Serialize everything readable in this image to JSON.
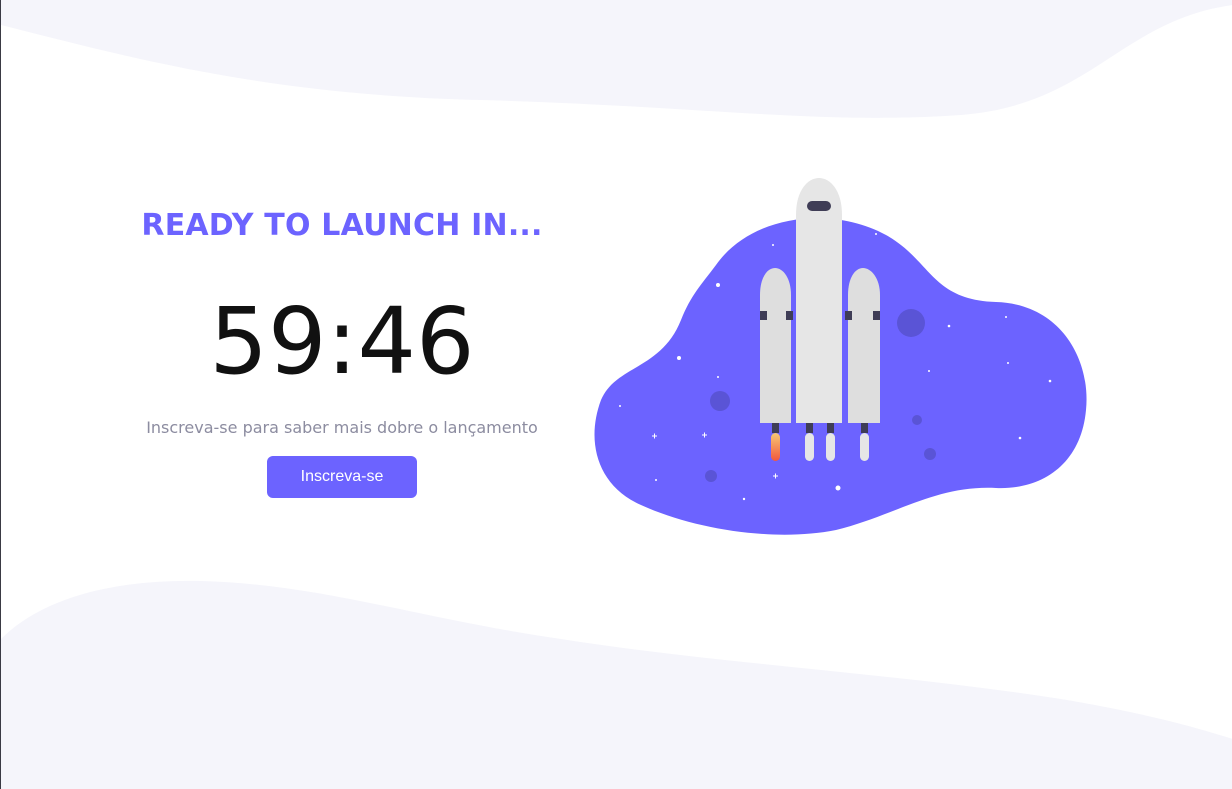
{
  "hero": {
    "heading": "READY TO LAUNCH IN...",
    "countdown": "59:46",
    "subtitle": "Inscreva-se para saber mais dobre o lançamento",
    "cta_label": "Inscreva-se"
  },
  "illustration": {
    "name": "rocket-launch-illustration"
  },
  "colors": {
    "accent": "#6c63ff",
    "wave": "#f5f5fb",
    "text_dark": "#111111",
    "text_muted": "#8c8ca0",
    "rocket_body": "#e6e6e6",
    "rocket_booster": "#dedede",
    "window": "#3f3d56"
  }
}
